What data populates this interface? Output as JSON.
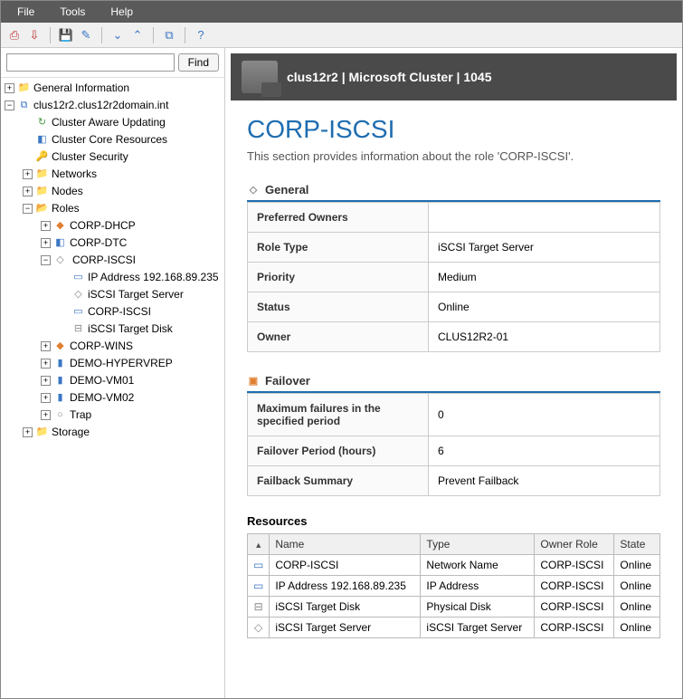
{
  "menu": {
    "file": "File",
    "tools": "Tools",
    "help": "Help"
  },
  "find": {
    "placeholder": "",
    "button": "Find"
  },
  "tree": {
    "general": "General Information",
    "cluster": "clus12r2.clus12r2domain.int",
    "cau": "Cluster Aware Updating",
    "ccr": "Cluster Core Resources",
    "cs": "Cluster Security",
    "networks": "Networks",
    "nodes": "Nodes",
    "roles": "Roles",
    "dhcp": "CORP-DHCP",
    "dtc": "CORP-DTC",
    "iscsi": "CORP-ISCSI",
    "ip": "IP Address 192.168.89.235",
    "its": "iSCSI Target Server",
    "ci": "CORP-ISCSI",
    "itd": "iSCSI Target Disk",
    "wins": "CORP-WINS",
    "hyperv": "DEMO-HYPERVREP",
    "vm1": "DEMO-VM01",
    "vm2": "DEMO-VM02",
    "trap": "Trap",
    "storage": "Storage"
  },
  "header": {
    "breadcrumb": "clus12r2 | Microsoft Cluster | 1045"
  },
  "page": {
    "title": "CORP-ISCSI",
    "desc": "This section provides information about the role 'CORP-ISCSI'."
  },
  "general": {
    "heading": "General",
    "rows": {
      "po_l": "Preferred Owners",
      "po_v": "",
      "rt_l": "Role Type",
      "rt_v": "iSCSI Target Server",
      "pr_l": "Priority",
      "pr_v": "Medium",
      "st_l": "Status",
      "st_v": "Online",
      "ow_l": "Owner",
      "ow_v": "CLUS12R2-01"
    }
  },
  "failover": {
    "heading": "Failover",
    "rows": {
      "mf_l": "Maximum failures in the specified period",
      "mf_v": "0",
      "fp_l": "Failover Period (hours)",
      "fp_v": "6",
      "fs_l": "Failback Summary",
      "fs_v": "Prevent Failback"
    }
  },
  "resources": {
    "heading": "Resources",
    "cols": {
      "name": "Name",
      "type": "Type",
      "owner": "Owner Role",
      "state": "State"
    },
    "rows": [
      {
        "name": "CORP-ISCSI",
        "type": "Network Name",
        "owner": "CORP-ISCSI",
        "state": "Online"
      },
      {
        "name": "IP Address 192.168.89.235",
        "type": "IP Address",
        "owner": "CORP-ISCSI",
        "state": "Online"
      },
      {
        "name": "iSCSI Target Disk",
        "type": "Physical Disk",
        "owner": "CORP-ISCSI",
        "state": "Online"
      },
      {
        "name": "iSCSI Target Server",
        "type": "iSCSI Target Server",
        "owner": "CORP-ISCSI",
        "state": "Online"
      }
    ]
  }
}
